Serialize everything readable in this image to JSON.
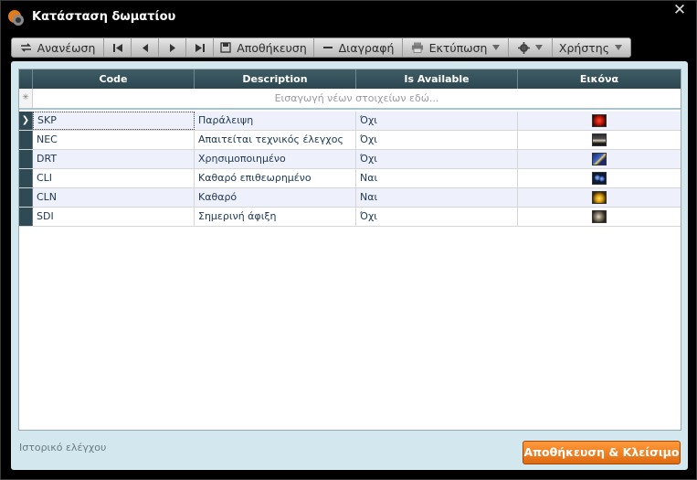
{
  "window": {
    "title": "Κατάσταση δωματίου",
    "close_glyph": "✕"
  },
  "toolbar": {
    "refresh_label": "Ανανέωση",
    "save_label": "Αποθήκευση",
    "delete_label": "Διαγραφή",
    "print_label": "Εκτύπωση",
    "users_label": "Χρήστης"
  },
  "grid": {
    "columns": [
      "Code",
      "Description",
      "Is Available",
      "Εικόνα"
    ],
    "new_row_placeholder": "Εισαγωγή νέων στοιχείων εδώ...",
    "new_row_glyph": "✳",
    "current_row_glyph": "❯",
    "rows": [
      {
        "code": "SKP",
        "description": "Παράλειψη",
        "available": "Όχι",
        "image_icon": "red-flower-thumbnail"
      },
      {
        "code": "NEC",
        "description": "Απαιτείται τεχνικός έλεγχος",
        "available": "Όχι",
        "image_icon": "landscape-thumbnail"
      },
      {
        "code": "DRT",
        "description": "Χρησιμοποιημένο",
        "available": "Όχι",
        "image_icon": "blue-sky-thumbnail"
      },
      {
        "code": "CLI",
        "description": "Καθαρό επιθεωρημένο",
        "available": "Ναι",
        "image_icon": "blue-dots-thumbnail"
      },
      {
        "code": "CLN",
        "description": "Καθαρό",
        "available": "Ναι",
        "image_icon": "yellow-flower-thumbnail"
      },
      {
        "code": "SDI",
        "description": "Σημερινή άφιξη",
        "available": "Όχι",
        "image_icon": "animal-thumbnail"
      }
    ]
  },
  "footer": {
    "history_link": "Ιστορικό ελέγχου",
    "save_close_label": "Αποθήκευση & Κλείσιμο"
  },
  "colors": {
    "accent": "#e06a10",
    "header": "#2c4650",
    "panel": "#d2e8ee"
  }
}
